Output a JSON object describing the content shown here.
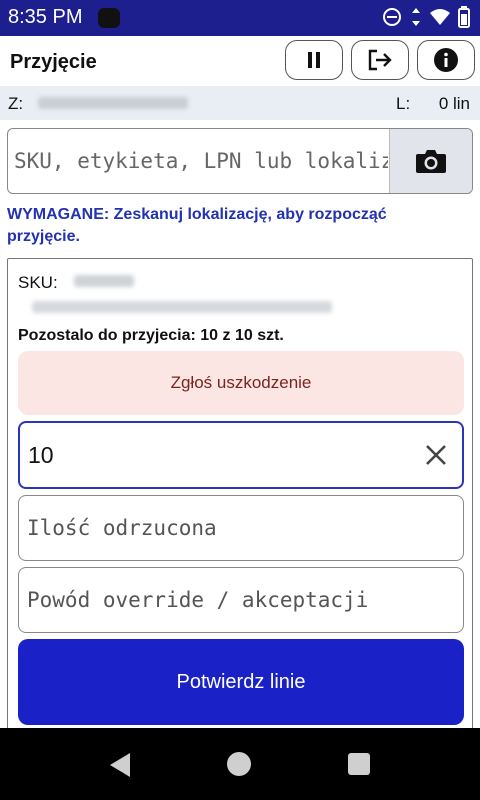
{
  "status_bar": {
    "time": "8:35 PM",
    "icons": [
      "dnd-icon",
      "data-arrows-icon",
      "wifi-icon",
      "battery-icon"
    ]
  },
  "app_bar": {
    "title": "Przyjęcie",
    "buttons": [
      {
        "name": "pause-button",
        "icon": "pause-icon"
      },
      {
        "name": "logout-button",
        "icon": "logout-icon"
      },
      {
        "name": "info-button",
        "icon": "info-icon"
      }
    ]
  },
  "info_bar": {
    "z_label": "Z:",
    "l_label": "L:",
    "l_value": "0 lin"
  },
  "scan": {
    "placeholder": "SKU, etykieta, LPN lub lokalizacja"
  },
  "required_message": "WYMAGANE: Zeskanuj lokalizację, aby rozpocząć przyjęcie.",
  "line": {
    "sku_label": "SKU:",
    "remaining": "Pozostalo do przyjecia: 10 z 10 szt.",
    "damage_button": "Zgłoś uszkodzenie",
    "quantity_value": "10",
    "rejected_placeholder": "Ilość odrzucona",
    "override_placeholder": "Powód override / akceptacji",
    "confirm_button": "Potwierdz linie"
  },
  "colors": {
    "status_bar": "#1e1f8f",
    "accent": "#1a22c7",
    "required_text": "#2232b0",
    "damage_bg": "#fbe6e3",
    "damage_text": "#7a2420"
  }
}
